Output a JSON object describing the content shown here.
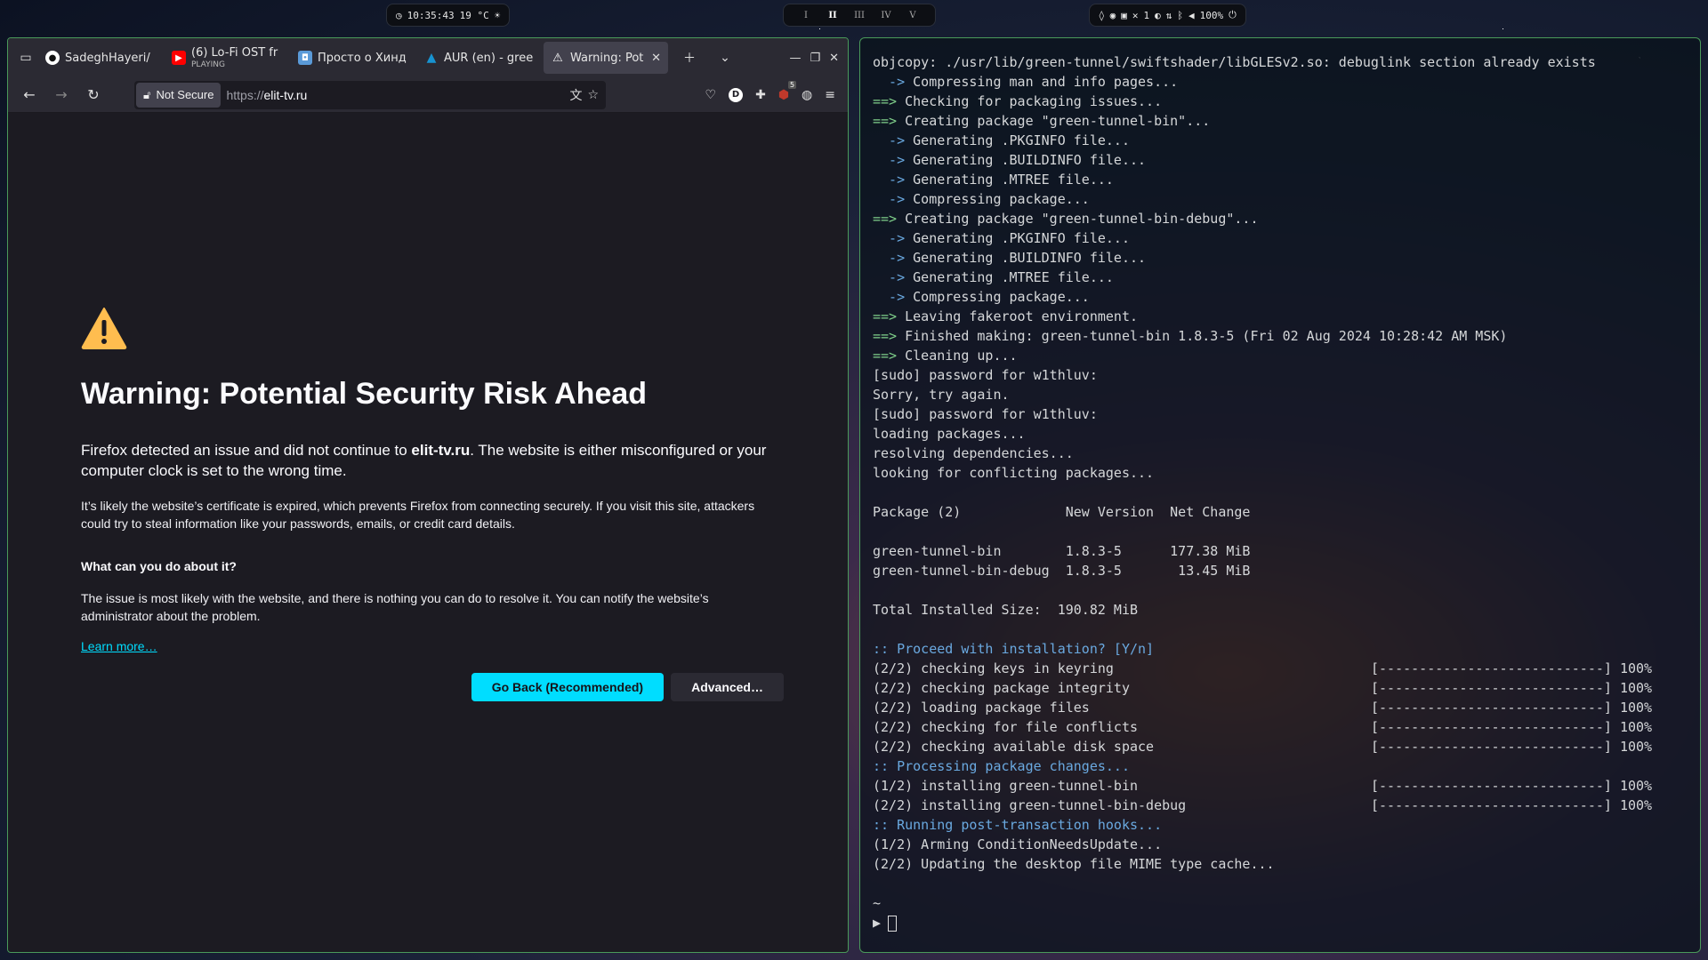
{
  "topbar": {
    "clock": "10:35:43",
    "temperature": "19 °C",
    "workspaces": [
      "I",
      "II",
      "III",
      "IV",
      "V"
    ],
    "battery": "100%",
    "notifications_count": "1"
  },
  "browser": {
    "tabs": [
      {
        "label": "SadeghHayeri/",
        "icon": "github-icon"
      },
      {
        "label": "(6) Lo-Fi OST fr",
        "sub": "PLAYING",
        "icon": "youtube-icon"
      },
      {
        "label": "Просто о Хинд",
        "icon": "site-icon"
      },
      {
        "label": "AUR (en) - gree",
        "icon": "arch-icon"
      },
      {
        "label": "Warning: Pot",
        "icon": "warning-icon",
        "active": true
      }
    ],
    "security_label": "Not Secure",
    "url_proto": "https://",
    "url_host": "elit-tv.ru",
    "extension_badge": "5",
    "page": {
      "title": "Warning: Potential Security Risk Ahead",
      "p1_before": "Firefox detected an issue and did not continue to ",
      "p1_host": "elit-tv.ru",
      "p1_after": ". The website is either misconfigured or your computer clock is set to the wrong time.",
      "p2": "It’s likely the website’s certificate is expired, which prevents Firefox from connecting securely. If you visit this site, attackers could try to steal information like your passwords, emails, or credit card details.",
      "heading": "What can you do about it?",
      "p3": "The issue is most likely with the website, and there is nothing you can do to resolve it. You can notify the website’s administrator about the problem.",
      "learn_more": "Learn more…",
      "go_back": "Go Back (Recommended)",
      "advanced": "Advanced…"
    }
  },
  "terminal": {
    "lines": [
      {
        "type": "plain",
        "text": "objcopy: ./usr/lib/green-tunnel/swiftshader/libGLESv2.so: debuglink section already exists"
      },
      {
        "type": "sub",
        "text": "Compressing man and info pages..."
      },
      {
        "type": "main",
        "text": "Checking for packaging issues..."
      },
      {
        "type": "main",
        "text": "Creating package \"green-tunnel-bin\"..."
      },
      {
        "type": "sub",
        "text": "Generating .PKGINFO file..."
      },
      {
        "type": "sub",
        "text": "Generating .BUILDINFO file..."
      },
      {
        "type": "sub",
        "text": "Generating .MTREE file..."
      },
      {
        "type": "sub",
        "text": "Compressing package..."
      },
      {
        "type": "main",
        "text": "Creating package \"green-tunnel-bin-debug\"..."
      },
      {
        "type": "sub",
        "text": "Generating .PKGINFO file..."
      },
      {
        "type": "sub",
        "text": "Generating .BUILDINFO file..."
      },
      {
        "type": "sub",
        "text": "Generating .MTREE file..."
      },
      {
        "type": "sub",
        "text": "Compressing package..."
      },
      {
        "type": "main",
        "text": "Leaving fakeroot environment."
      },
      {
        "type": "main",
        "text": "Finished making: green-tunnel-bin 1.8.3-5 (Fri 02 Aug 2024 10:28:42 AM MSK)"
      },
      {
        "type": "main",
        "text": "Cleaning up..."
      },
      {
        "type": "plain",
        "text": "[sudo] password for w1thluv:"
      },
      {
        "type": "plain",
        "text": "Sorry, try again."
      },
      {
        "type": "plain",
        "text": "[sudo] password for w1thluv:"
      },
      {
        "type": "plain",
        "text": "loading packages..."
      },
      {
        "type": "plain",
        "text": "resolving dependencies..."
      },
      {
        "type": "plain",
        "text": "looking for conflicting packages..."
      },
      {
        "type": "plain",
        "text": ""
      },
      {
        "type": "plain",
        "text": "Package (2)             New Version  Net Change"
      },
      {
        "type": "plain",
        "text": ""
      },
      {
        "type": "plain",
        "text": "green-tunnel-bin        1.8.3-5      177.38 MiB"
      },
      {
        "type": "plain",
        "text": "green-tunnel-bin-debug  1.8.3-5       13.45 MiB"
      },
      {
        "type": "plain",
        "text": ""
      },
      {
        "type": "plain",
        "text": "Total Installed Size:  190.82 MiB"
      },
      {
        "type": "plain",
        "text": ""
      },
      {
        "type": "colon",
        "text": ":: Proceed with installation? [Y/n]"
      },
      {
        "type": "progress",
        "text": "(2/2) checking keys in keyring",
        "bar": "[----------------------------] 100%"
      },
      {
        "type": "progress",
        "text": "(2/2) checking package integrity",
        "bar": "[----------------------------] 100%"
      },
      {
        "type": "progress",
        "text": "(2/2) loading package files",
        "bar": "[----------------------------] 100%"
      },
      {
        "type": "progress",
        "text": "(2/2) checking for file conflicts",
        "bar": "[----------------------------] 100%"
      },
      {
        "type": "progress",
        "text": "(2/2) checking available disk space",
        "bar": "[----------------------------] 100%"
      },
      {
        "type": "colon",
        "text": ":: Processing package changes..."
      },
      {
        "type": "progress",
        "text": "(1/2) installing green-tunnel-bin",
        "bar": "[----------------------------] 100%"
      },
      {
        "type": "progress",
        "text": "(2/2) installing green-tunnel-bin-debug",
        "bar": "[----------------------------] 100%"
      },
      {
        "type": "colon",
        "text": ":: Running post-transaction hooks..."
      },
      {
        "type": "plain",
        "text": "(1/2) Arming ConditionNeedsUpdate..."
      },
      {
        "type": "plain",
        "text": "(2/2) Updating the desktop file MIME type cache..."
      }
    ],
    "cwd": "~",
    "prompt_symbol": "▶"
  }
}
